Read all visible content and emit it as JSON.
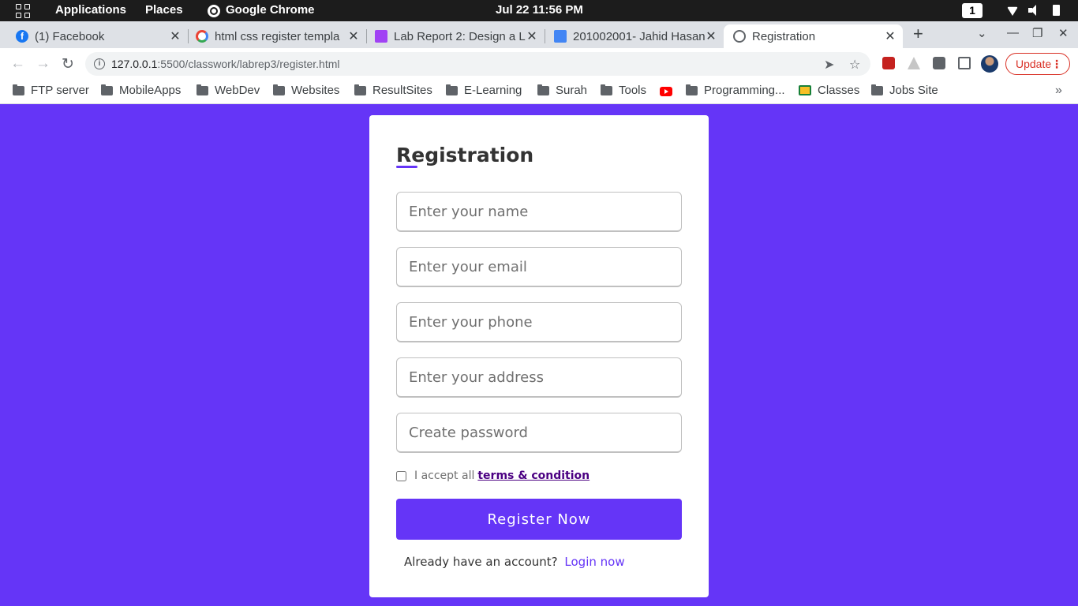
{
  "topbar": {
    "activities_icon": "grid-icon",
    "applications": "Applications",
    "places": "Places",
    "app_name": "Google Chrome",
    "clock": "Jul 22  11:56 PM",
    "workspace": "1"
  },
  "tabs": [
    {
      "title": "(1) Facebook",
      "icon": "facebook-icon"
    },
    {
      "title": "html css register templa",
      "icon": "google-icon"
    },
    {
      "title": "Lab Report 2: Design a L",
      "icon": "classroom-icon"
    },
    {
      "title": "201002001- Jahid Hasan",
      "icon": "docs-icon"
    },
    {
      "title": "Registration",
      "icon": "globe-icon",
      "active": true
    }
  ],
  "toolbar": {
    "url_host": "127.0.0.1",
    "url_path": ":5500/classwork/labrep3/register.html",
    "update_label": "Update"
  },
  "bookmarks": [
    {
      "label": "FTP server",
      "type": "folder"
    },
    {
      "label": "MobileApps",
      "type": "folder"
    },
    {
      "label": "WebDev",
      "type": "folder"
    },
    {
      "label": "Websites",
      "type": "folder"
    },
    {
      "label": "ResultSites",
      "type": "folder"
    },
    {
      "label": "E-Learning",
      "type": "folder"
    },
    {
      "label": "Surah",
      "type": "folder"
    },
    {
      "label": "Tools",
      "type": "folder"
    },
    {
      "label": "",
      "type": "youtube"
    },
    {
      "label": "Programming...",
      "type": "folder"
    },
    {
      "label": "Classes",
      "type": "classroom"
    },
    {
      "label": "Jobs Site",
      "type": "folder"
    }
  ],
  "form": {
    "title": "Registration",
    "name_placeholder": "Enter your name",
    "email_placeholder": "Enter your email",
    "phone_placeholder": "Enter your phone",
    "address_placeholder": "Enter your address",
    "password_placeholder": "Create password",
    "terms_prefix": "I accept all",
    "terms_link": "terms & condition",
    "submit_label": "Register Now",
    "login_prefix": "Already have an account?",
    "login_link": "Login now"
  },
  "colors": {
    "accent": "#6535f7",
    "link_dark": "#4b0082"
  }
}
